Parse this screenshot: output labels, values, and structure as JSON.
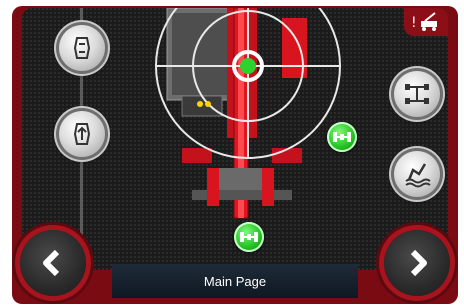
{
  "footer": {
    "page_label": "Main Page"
  },
  "icons": {
    "prev": "chevron-left-icon",
    "next": "chevron-right-icon",
    "alert": "warning-machine-icon",
    "top_left_button": "track-rotate-icon",
    "mid_left_button": "track-rotate-alt-icon",
    "top_right_button": "axle-differential-icon",
    "bottom_right_button": "ground-level-icon",
    "green_indicator": "axle-lock-icon"
  },
  "colors": {
    "frame": "#7a0b12",
    "accent_red": "#d8141e",
    "indicator_green": "#22c322",
    "label_bar": "#1e2b38"
  }
}
